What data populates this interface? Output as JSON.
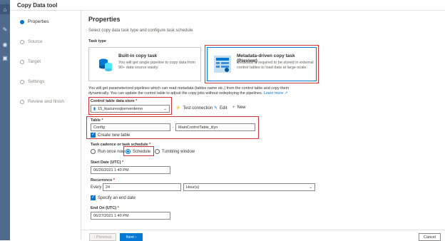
{
  "window": {
    "title": "Copy Data tool"
  },
  "steps": [
    {
      "label": "Properties",
      "active": true
    },
    {
      "label": "Source",
      "active": false
    },
    {
      "label": "Target",
      "active": false
    },
    {
      "label": "Settings",
      "active": false
    },
    {
      "label": "Review and finish",
      "active": false
    }
  ],
  "main": {
    "title": "Properties",
    "subtitle": "Select copy data task type and configure task schedule",
    "task_type_label": "Task type",
    "builtin": {
      "title": "Built-in copy task",
      "desc": "You will get single pipeline to copy data from 90+ data source easily."
    },
    "metadata": {
      "title": "Metadata-driven copy task (Preview)",
      "desc": "Metadata is required to be stored in external control tables to load data at large-scale."
    },
    "info_line1": "You will get parameterized pipelines which can read metadata (tables name etc.) from the control table and copy them",
    "info_line2": "dynamically. You can update the control table to adjust the copy jobs without redeploying the pipelines.",
    "learn_more": "Learn more",
    "control_store": {
      "label": "Control table data store",
      "required": "*",
      "value": "15_lkazuresqlserverdemo",
      "test": "Test connection",
      "edit": "Edit",
      "new": "New"
    },
    "table": {
      "label": "Table",
      "required": "*",
      "schema": "Config",
      "separator": ".",
      "name": "MainControlTable_iilyn",
      "create_new": "Create new table"
    },
    "schedule": {
      "label": "Task cadence or task schedule",
      "required": "*",
      "options": [
        "Run once now",
        "Schedule",
        "Tumbling window"
      ],
      "selected": "Schedule"
    },
    "start": {
      "label": "Start Date (UTC)",
      "required": "*",
      "value": "06/26/2021 1:40 PM"
    },
    "recurrence": {
      "label": "Recurrence",
      "required": "*",
      "every": "Every",
      "value": "24",
      "unit": "Hour(s)"
    },
    "end_checkbox": "Specify an end date",
    "end": {
      "label": "End On (UTC)",
      "required": "*",
      "value": "06/27/2021 1:40 PM"
    }
  },
  "footer": {
    "previous": "Previous",
    "next": "Next",
    "cancel": "Cancel"
  },
  "colors": {
    "accent": "#0078d4",
    "highlight": "#d13438",
    "rail": "#4e6a8d"
  }
}
